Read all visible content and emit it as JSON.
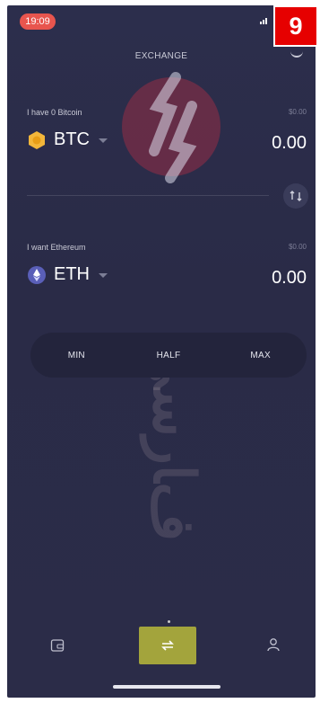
{
  "status": {
    "time": "19:09"
  },
  "badge": {
    "number": "9"
  },
  "header": {
    "title": "EXCHANGE"
  },
  "from": {
    "label": "I have 0 Bitcoin",
    "usd": "$0.00",
    "symbol": "BTC",
    "amount": "0.00",
    "icon": "bitcoin-icon",
    "color": "#f3b63a"
  },
  "to": {
    "label": "I want Ethereum",
    "usd": "$0.00",
    "symbol": "ETH",
    "amount": "0.00",
    "icon": "ethereum-icon",
    "color": "#8a8ff0"
  },
  "percent_buttons": {
    "min": "MIN",
    "half": "HALF",
    "max": "MAX"
  },
  "nav": {
    "items": [
      {
        "name": "wallet",
        "icon": "wallet-icon"
      },
      {
        "name": "exchange",
        "icon": "swap-icon",
        "active": true
      },
      {
        "name": "profile",
        "icon": "user-icon"
      }
    ],
    "active_color": "#a3a43c"
  }
}
